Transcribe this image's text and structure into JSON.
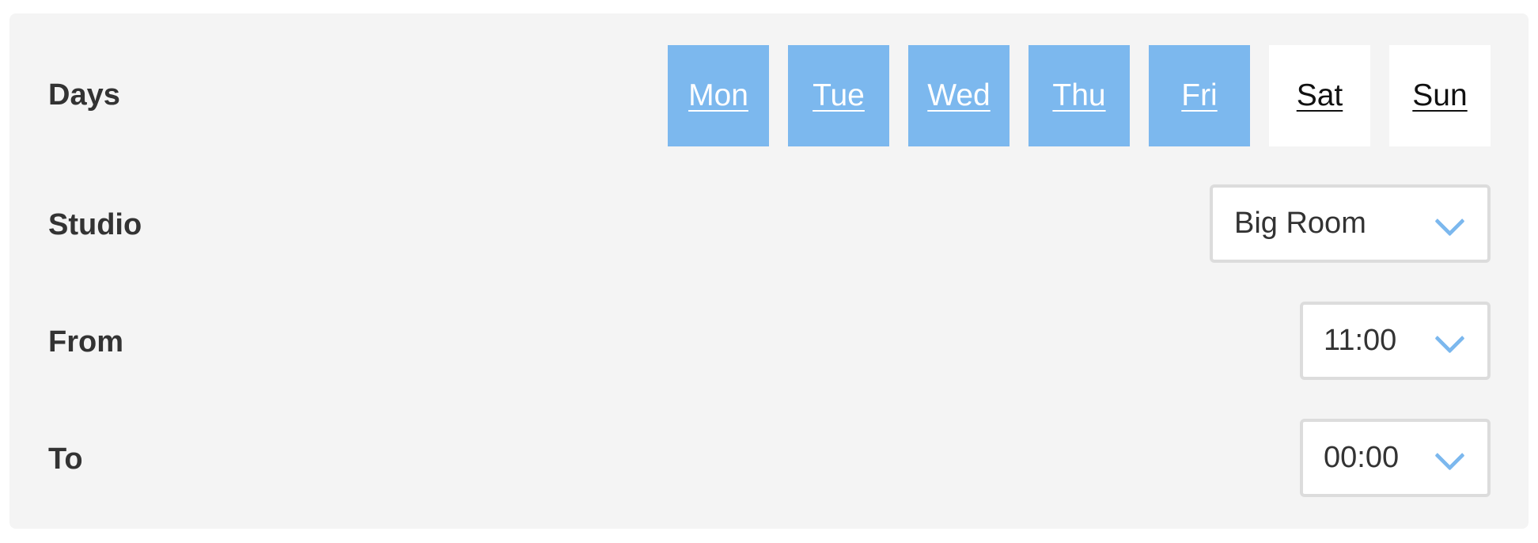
{
  "form": {
    "days": {
      "label": "Days",
      "items": [
        {
          "label": "Mon",
          "selected": true
        },
        {
          "label": "Tue",
          "selected": true
        },
        {
          "label": "Wed",
          "selected": true
        },
        {
          "label": "Thu",
          "selected": true
        },
        {
          "label": "Fri",
          "selected": true
        },
        {
          "label": "Sat",
          "selected": false
        },
        {
          "label": "Sun",
          "selected": false
        }
      ]
    },
    "studio": {
      "label": "Studio",
      "value": "Big Room"
    },
    "from": {
      "label": "From",
      "value": "11:00"
    },
    "to": {
      "label": "To",
      "value": "00:00"
    }
  },
  "colors": {
    "accent": "#7cb8ee",
    "panel_bg": "#f4f4f4",
    "label_text": "#333333",
    "select_border": "#dcdcdc"
  }
}
